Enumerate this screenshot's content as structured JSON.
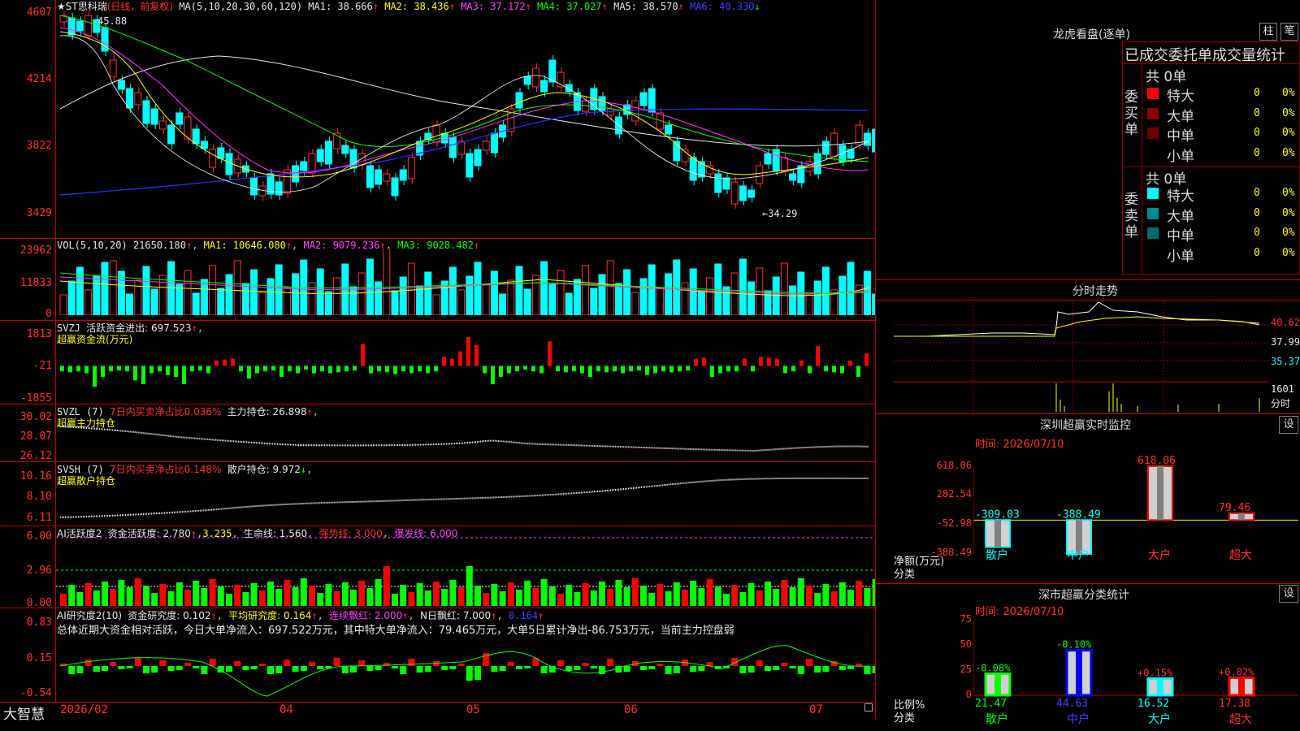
{
  "title": {
    "name": "★ST思科瑞",
    "period": "(日线，前复权)",
    "ma_label": "MA(5,10,20,30,60,120)",
    "ma1": "MA1: 38.666",
    "ma2": "MA2: 38.436",
    "ma3": "MA3: 37.172",
    "ma4": "MA4: 37.027",
    "ma5": "MA5: 38.570",
    "ma6": "MA6: 40.330",
    "up": "↑",
    "down": "↓"
  },
  "price_axis": [
    "4607",
    "4214",
    "3822",
    "3429"
  ],
  "price_marks": {
    "high": "45.88",
    "low": "←34.29"
  },
  "vol": {
    "label": "VOL(5,10,20)",
    "value": "21650.180",
    "ma1": "MA1: 10646.080",
    "ma2": "MA2: 9079.236",
    "ma3": "MA3: 9028.482",
    "axis": [
      "23962",
      "11833",
      "0"
    ]
  },
  "svzj": {
    "label": "SVZJ",
    "text": "活跃资金进出: 697.523",
    "sub": "超赢资金流(万元)",
    "axis": [
      "1813",
      "-21",
      "-1855"
    ]
  },
  "svzl": {
    "label": "SVZL (7)",
    "text1": "7日内买卖净占比0.036%",
    "text2": "主力持仓: 26.898",
    "sub": "超赢主力持仓",
    "axis": [
      "30.02",
      "28.07",
      "26.12"
    ]
  },
  "svsh": {
    "label": "SVSH (7)",
    "text1": "7日内买卖净占比0.148%",
    "text2": "散户持仓: 9.972",
    "sub": "超赢散户持仓",
    "axis": [
      "10.16",
      "8.10",
      "6.11"
    ]
  },
  "ai1": {
    "label": "AI活跃度2",
    "t1": "资金活跃度: 2.780",
    "t2": "3.235",
    "t3": "生命线: 1.560",
    "t4": "强势线: 3.000",
    "t5": "爆发线: 6.000",
    "axis": [
      "6.00",
      "2.96",
      "0.00"
    ]
  },
  "ai2": {
    "label": "AI研究度2(10)",
    "t1": "资金研究度: 0.102",
    "t2": "平均研究度: 0.164",
    "t3": "连续飘红: 2.000",
    "t4": "N日飘红: 7.000",
    "t5": "0.164",
    "summary": "总体近期大资金相对活跃，今日大单净流入：697.522万元，其中特大单净流入：79.465万元，大单5日累计净出-86.753万元，当前主力控盘弱",
    "axis": [
      "0.83",
      "0.15",
      "-0.54"
    ]
  },
  "date_axis": {
    "brand": "大智慧",
    "labels": [
      "2026/02",
      "04",
      "05",
      "06",
      "07"
    ]
  },
  "lhb": {
    "title": "龙虎看盘(逐单)",
    "btn1": "柱",
    "btn2": "笔",
    "header": "已成交委托单成交量统计",
    "buy": {
      "side": "委买单",
      "total": "共 0单",
      "rows": [
        {
          "name": "特大",
          "v": "0",
          "p": "0%",
          "color": "#ff0000"
        },
        {
          "name": "大单",
          "v": "0",
          "p": "0%",
          "color": "#8b0000"
        },
        {
          "name": "中单",
          "v": "0",
          "p": "0%",
          "color": "#6b0000"
        },
        {
          "name": "小单",
          "v": "0",
          "p": "0%",
          "color": ""
        }
      ]
    },
    "sell": {
      "side": "委卖单",
      "total": "共 0单",
      "rows": [
        {
          "name": "特大",
          "v": "0",
          "p": "0%",
          "color": "#00ffff"
        },
        {
          "name": "大单",
          "v": "0",
          "p": "0%",
          "color": "#008b8b"
        },
        {
          "name": "中单",
          "v": "0",
          "p": "0%",
          "color": "#006b6b"
        },
        {
          "name": "小单",
          "v": "0",
          "p": "0%",
          "color": ""
        }
      ]
    }
  },
  "fenshi": {
    "title": "分时走势",
    "axis": [
      "40.62",
      "37.99",
      "35.37"
    ],
    "vol": [
      "1601",
      "分时"
    ]
  },
  "monitor": {
    "title": "深圳超赢实时监控",
    "btn": "设",
    "time": "时间: 2026/07/10",
    "ylabel": "净额(万元)",
    "xlabel": "分类",
    "axis": [
      "618.06",
      "282.54",
      "-52.98",
      "-388.49"
    ]
  },
  "stats": {
    "title": "深市超赢分类统计",
    "btn": "设",
    "time": "时间: 2026/07/10",
    "ylabel": "比例%",
    "xlabel": "分类",
    "axis": [
      "75",
      "50",
      "25",
      "0"
    ]
  },
  "chart_data": [
    {
      "type": "bar",
      "title": "深圳超赢实时监控",
      "categories": [
        "散户",
        "中户",
        "大户",
        "超大"
      ],
      "values": [
        -309.03,
        -388.49,
        618.06,
        79.46
      ],
      "ylabel": "净额(万元)",
      "xlabel": "分类",
      "ylim": [
        -388.49,
        618.06
      ],
      "colors": [
        "#00ffff",
        "#00ffff",
        "#ff0000",
        "#ff0000"
      ]
    },
    {
      "type": "bar",
      "title": "深市超赢分类统计",
      "categories": [
        "散户",
        "中户",
        "大户",
        "超大"
      ],
      "values": [
        21.47,
        44.63,
        16.52,
        17.38
      ],
      "changes": [
        "-0.08%",
        "-0.10%",
        "+0.15%",
        "+0.02%"
      ],
      "ylabel": "比例%",
      "xlabel": "分类",
      "ylim": [
        0,
        75
      ],
      "colors": [
        "#00ff00",
        "#0000ff",
        "#00ffff",
        "#ff0000"
      ]
    },
    {
      "type": "bar",
      "title": "SVZJ 超赢资金流(万元)",
      "ylim": [
        -1855,
        1813
      ],
      "values": [
        -300,
        -350,
        -300,
        -400,
        -1150,
        -600,
        -300,
        -250,
        -300,
        -800,
        -1000,
        -400,
        -300,
        -500,
        -600,
        -1000,
        -300,
        -250,
        -400,
        300,
        350,
        400,
        -300,
        -700,
        -400,
        -300,
        -250,
        -600,
        -300,
        -400,
        -200,
        -400,
        -300,
        -400,
        -350,
        -300,
        -250,
        1200,
        -400,
        -300,
        -350,
        -450,
        -300,
        -400,
        -300,
        -400,
        -300,
        500,
        400,
        800,
        1600,
        1150,
        -400,
        -1000,
        -600,
        -400,
        -300,
        -200,
        -300,
        -400,
        1350,
        -300,
        -350,
        -300,
        -400,
        -600,
        -300,
        -350,
        -300,
        -400,
        -300,
        -250,
        -500,
        -400,
        -300,
        -350,
        -300,
        -250,
        400,
        450,
        -600,
        -400,
        -300,
        -300,
        400,
        -300,
        500,
        450,
        400,
        -400,
        -300,
        300,
        -400,
        1100,
        -300,
        -350,
        -400,
        300,
        -600,
        700
      ]
    }
  ]
}
